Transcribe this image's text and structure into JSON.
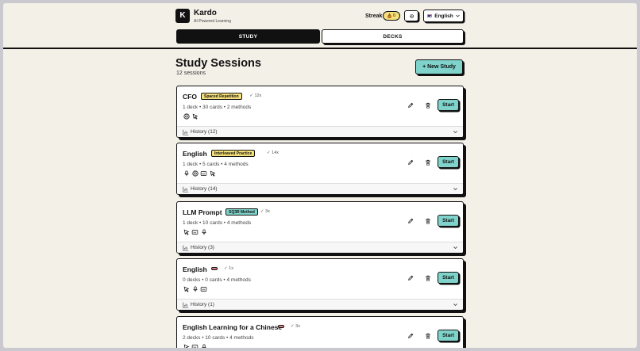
{
  "header": {
    "logo_letter": "K",
    "brand": "Kardo",
    "tagline": "AI-Powered Learning",
    "streak_label": "Streak",
    "streak_count": "0",
    "language": "English",
    "tabs": [
      {
        "label": "STUDY",
        "active": true
      },
      {
        "label": "DECKS",
        "active": false
      }
    ]
  },
  "main": {
    "title": "Study Sessions",
    "subtitle": "12 sessions",
    "new_button": "+ New Study",
    "start_label": "Start"
  },
  "sessions": [
    {
      "title": "CFO",
      "method": "Spaced Repetition",
      "method_color": "#f6e07a",
      "count": "12x",
      "meta": "1 deck • 30 cards • 2 methods",
      "icons": [
        "brain-icon",
        "cursor-icon"
      ],
      "history": "History (12)"
    },
    {
      "title": "English",
      "method": "Interleaved Practice",
      "method_color": "#f6e07a",
      "count": "14x",
      "meta": "1 deck • 5 cards • 4 methods",
      "icons": [
        "mic-icon",
        "brain-icon",
        "keyboard-icon",
        "cursor-icon"
      ],
      "history": "History (14)"
    },
    {
      "title": "LLM Prompt",
      "method": "SQ3R Method",
      "method_color": "#7fd3cb",
      "count": "3x",
      "meta": "1 deck • 10 cards • 4 methods",
      "icons": [
        "cursor-icon",
        "keyboard-icon",
        "mic-icon"
      ],
      "history": "History (3)"
    },
    {
      "title": "English",
      "method": "",
      "method_color": "#e88080",
      "count": "1x",
      "meta": "0 decks • 0 cards • 4 methods",
      "icons": [
        "cursor-icon",
        "mic-icon",
        "keyboard-icon"
      ],
      "history": "History (1)"
    },
    {
      "title": "English Learning for a Chinese",
      "method": "",
      "method_color": "#e88080",
      "count": "3x",
      "meta": "2 decks • 10 cards • 4 methods",
      "icons": [
        "cursor-icon",
        "keyboard-icon",
        "mic-icon"
      ],
      "history": ""
    }
  ]
}
